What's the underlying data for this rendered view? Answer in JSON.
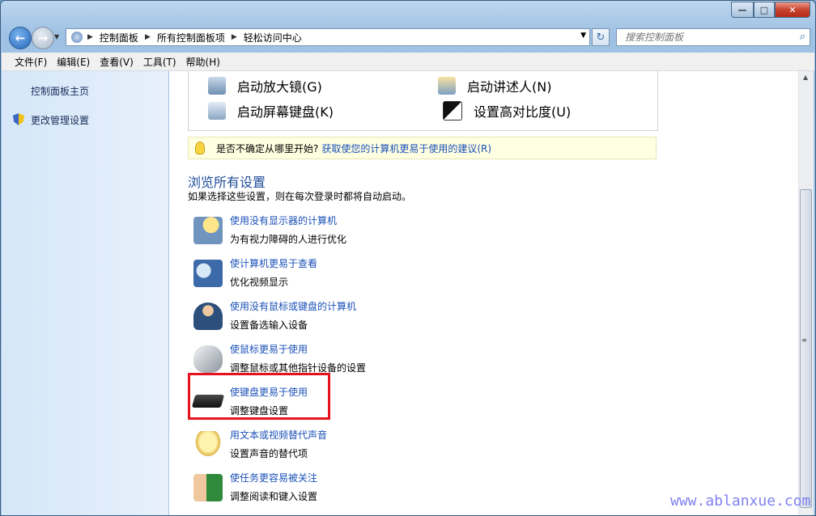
{
  "window": {
    "min": "—",
    "max": "□",
    "close": "✕"
  },
  "nav": {
    "crumbs": [
      "控制面板",
      "所有控制面板项",
      "轻松访问中心"
    ],
    "search_placeholder": "搜索控制面板"
  },
  "menu": [
    "文件(F)",
    "编辑(E)",
    "查看(V)",
    "工具(T)",
    "帮助(H)"
  ],
  "left": {
    "home": "控制面板主页",
    "admin": "更改管理设置"
  },
  "tools": [
    {
      "label": "启动放大镜(G)",
      "icon": "magnifier-icon"
    },
    {
      "label": "启动讲述人(N)",
      "icon": "narrator-icon"
    },
    {
      "label": "启动屏幕键盘(K)",
      "icon": "on-screen-keyboard-icon"
    },
    {
      "label": "设置高对比度(U)",
      "icon": "high-contrast-icon"
    }
  ],
  "hint": {
    "text": "是否不确定从哪里开始?",
    "link": "获取使您的计算机更易于使用的建议(R)"
  },
  "browse": {
    "heading": "浏览所有设置",
    "subtitle": "如果选择这些设置，则在每次登录时都将自动启动。"
  },
  "items": [
    {
      "title": "使用没有显示器的计算机",
      "desc": "为有视力障碍的人进行优化",
      "icon": "monitor-speech-icon"
    },
    {
      "title": "使计算机更易于查看",
      "desc": "优化视频显示",
      "icon": "monitor-magnifier-icon"
    },
    {
      "title": "使用没有鼠标或键盘的计算机",
      "desc": "设置备选输入设备",
      "icon": "person-icon"
    },
    {
      "title": "使鼠标更易于使用",
      "desc": "调整鼠标或其他指针设备的设置",
      "icon": "mouse-icon"
    },
    {
      "title": "使键盘更易于使用",
      "desc": "调整键盘设置",
      "icon": "keyboard-icon"
    },
    {
      "title": "用文本或视频替代声音",
      "desc": "设置声音的替代项",
      "icon": "speech-bubble-icon"
    },
    {
      "title": "使任务更容易被关注",
      "desc": "调整阅读和键入设置",
      "icon": "person-window-icon"
    }
  ],
  "watermark": "www.ablanxue.com"
}
